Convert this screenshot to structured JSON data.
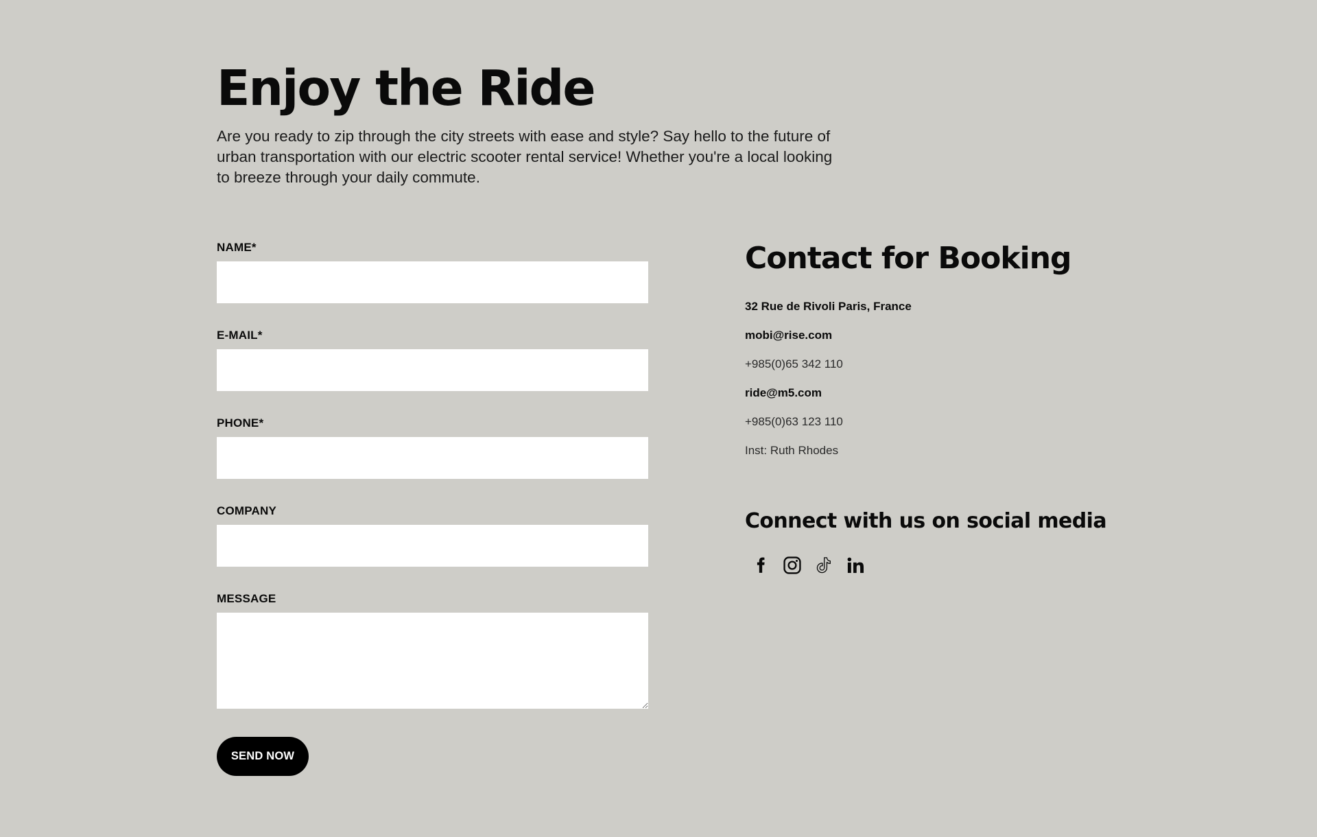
{
  "hero": {
    "title": "Enjoy the Ride",
    "text": "Are you ready to zip through the city streets with ease and style? Say hello to the future of urban transportation with our electric scooter rental service! Whether you're a local looking to breeze through your daily commute."
  },
  "form": {
    "fields": [
      {
        "label": "NAME*",
        "value": ""
      },
      {
        "label": "E-MAIL*",
        "value": ""
      },
      {
        "label": "PHONE*",
        "value": ""
      },
      {
        "label": "COMPANY",
        "value": ""
      },
      {
        "label": "MESSAGE",
        "value": ""
      }
    ],
    "submit_label": "SEND NOW"
  },
  "contact": {
    "title": "Contact for Booking",
    "address": "32 Rue de Rivoli Paris, France",
    "email_1": "mobi@rise.com",
    "phone_1": "+985(0)65 342 110",
    "email_2": "ride@m5.com",
    "phone_2": "+985(0)63 123 110",
    "inst": "Inst: Ruth Rhodes"
  },
  "social": {
    "title": "Connect with us on social media",
    "icons": [
      "facebook-icon",
      "instagram-icon",
      "tiktok-icon",
      "linkedin-icon"
    ]
  },
  "colors": {
    "background": "#cecdc8",
    "text": "#0a0a0a",
    "input_background": "#ffffff",
    "button_background": "#000000",
    "button_text": "#ffffff"
  }
}
